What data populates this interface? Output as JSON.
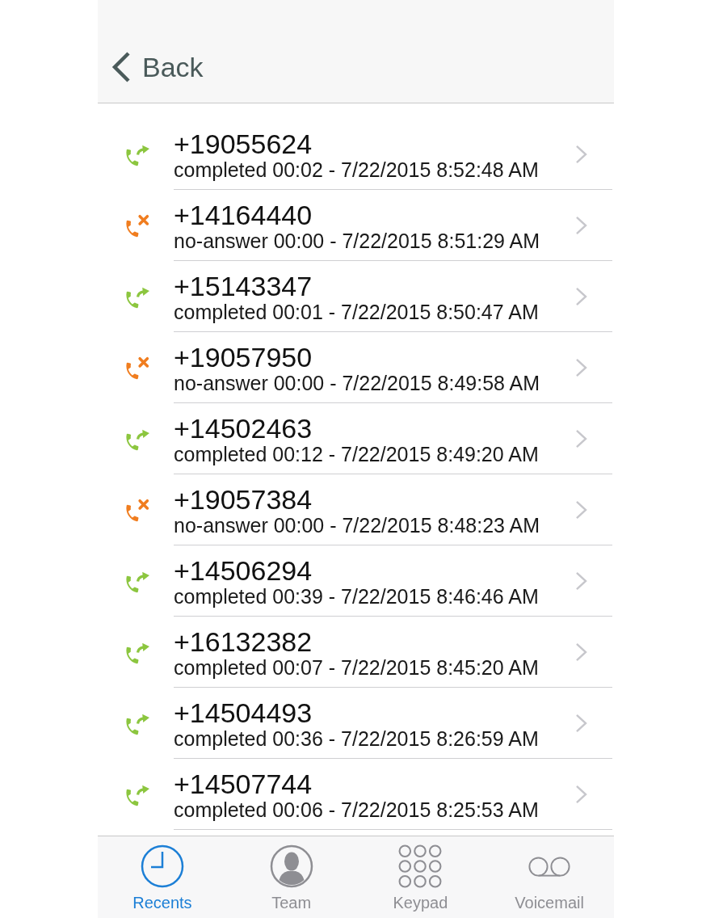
{
  "header": {
    "back_label": "Back"
  },
  "calls": [
    {
      "number": "+19055624",
      "detail": "completed 00:02 - 7/22/2015 8:52:48 AM",
      "kind": "answered"
    },
    {
      "number": "+14164440",
      "detail": "no-answer 00:00 - 7/22/2015 8:51:29 AM",
      "kind": "missed"
    },
    {
      "number": "+15143347",
      "detail": "completed 00:01 - 7/22/2015 8:50:47 AM",
      "kind": "answered"
    },
    {
      "number": "+19057950",
      "detail": "no-answer 00:00 - 7/22/2015 8:49:58 AM",
      "kind": "missed"
    },
    {
      "number": "+14502463",
      "detail": "completed 00:12 - 7/22/2015 8:49:20 AM",
      "kind": "answered"
    },
    {
      "number": "+19057384",
      "detail": "no-answer 00:00 - 7/22/2015 8:48:23 AM",
      "kind": "missed"
    },
    {
      "number": "+14506294",
      "detail": "completed 00:39 - 7/22/2015 8:46:46 AM",
      "kind": "answered"
    },
    {
      "number": "+16132382",
      "detail": "completed 00:07 - 7/22/2015 8:45:20 AM",
      "kind": "answered"
    },
    {
      "number": "+14504493",
      "detail": "completed 00:36 - 7/22/2015 8:26:59 AM",
      "kind": "answered"
    },
    {
      "number": "+14507744",
      "detail": "completed 00:06 - 7/22/2015 8:25:53 AM",
      "kind": "answered"
    }
  ],
  "tab_bar": {
    "tabs": [
      {
        "label": "Recents",
        "kind": "clock",
        "selected": true
      },
      {
        "label": "Team",
        "kind": "person",
        "selected": false
      },
      {
        "label": "Keypad",
        "kind": "keypad",
        "selected": false
      },
      {
        "label": "Voicemail",
        "kind": "voicemail",
        "selected": false
      }
    ]
  }
}
